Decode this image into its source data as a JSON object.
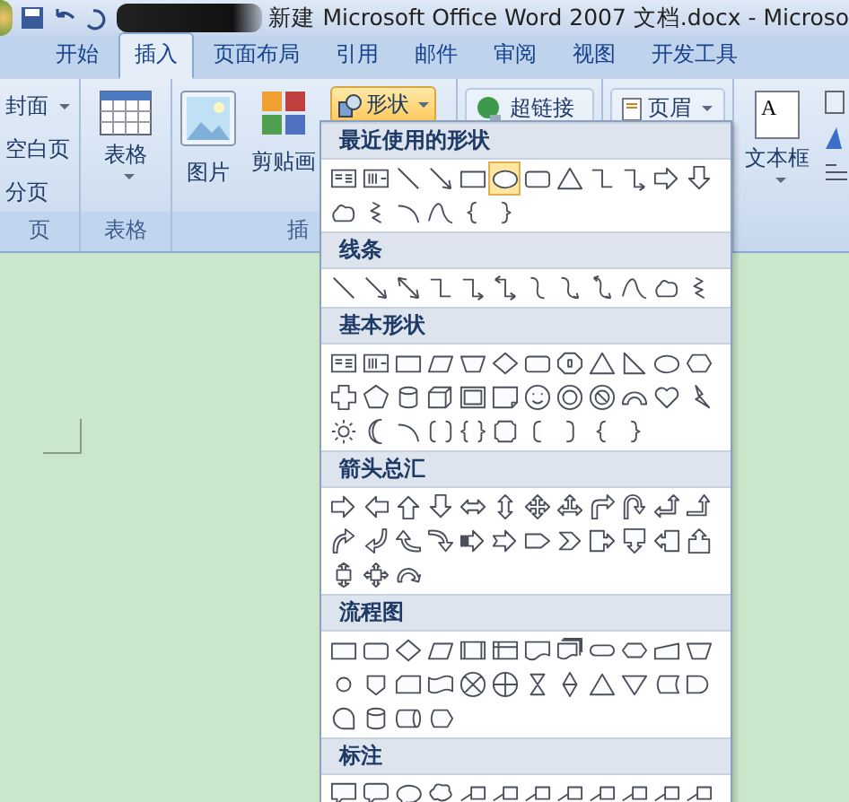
{
  "title_bar": {
    "title": "新建 Microsoft Office Word 2007 文档.docx - Microso"
  },
  "tabs": [
    {
      "label": "开始",
      "selected": false
    },
    {
      "label": "插入",
      "selected": true
    },
    {
      "label": "页面布局",
      "selected": false
    },
    {
      "label": "引用",
      "selected": false
    },
    {
      "label": "邮件",
      "selected": false
    },
    {
      "label": "审阅",
      "selected": false
    },
    {
      "label": "视图",
      "selected": false
    },
    {
      "label": "开发工具",
      "selected": false
    }
  ],
  "ribbon": {
    "pages_group": {
      "label": "页",
      "buttons": [
        {
          "label": "封面",
          "dropdown": true
        },
        {
          "label": "空白页",
          "dropdown": false
        },
        {
          "label": "分页",
          "dropdown": false
        }
      ]
    },
    "table_group": {
      "label": "表格",
      "button": "表格"
    },
    "illustrations_group": {
      "label": "插",
      "buttons": [
        {
          "label": "图片"
        },
        {
          "label": "剪贴画"
        }
      ],
      "shapes_button": {
        "label": "形状",
        "open": true
      }
    },
    "links_group": {
      "button": "超链接"
    },
    "header_group": {
      "button": "页眉"
    },
    "text_group": {
      "button": "文本框",
      "icon_letter": "A"
    }
  },
  "shapes_menu": {
    "sections": [
      {
        "title": "最近使用的形状",
        "shapes": [
          {
            "kind": "textbox",
            "selected": false
          },
          {
            "kind": "vtextbox",
            "selected": false
          },
          {
            "kind": "line",
            "selected": false
          },
          {
            "kind": "arrow-line",
            "selected": false
          },
          {
            "kind": "rect",
            "selected": false
          },
          {
            "kind": "oval",
            "selected": true
          },
          {
            "kind": "rounded-rect",
            "selected": false
          },
          {
            "kind": "triangle",
            "selected": false
          },
          {
            "kind": "elbow",
            "selected": false
          },
          {
            "kind": "elbow-arrow",
            "selected": false
          },
          {
            "kind": "arrow-right",
            "selected": false
          },
          {
            "kind": "arrow-down",
            "selected": false
          },
          {
            "kind": "freeform",
            "selected": false
          },
          {
            "kind": "scribble",
            "selected": false
          },
          {
            "kind": "arc",
            "selected": false
          },
          {
            "kind": "curve",
            "selected": false
          },
          {
            "kind": "brace-left",
            "selected": false
          },
          {
            "kind": "brace-right",
            "selected": false
          }
        ]
      },
      {
        "title": "线条",
        "shapes": [
          {
            "kind": "line",
            "selected": false
          },
          {
            "kind": "arrow-line",
            "selected": false
          },
          {
            "kind": "double-arrow-line",
            "selected": false
          },
          {
            "kind": "elbow",
            "selected": false
          },
          {
            "kind": "elbow-arrow",
            "selected": false
          },
          {
            "kind": "elbow-double-arrow",
            "selected": false
          },
          {
            "kind": "curve-connector",
            "selected": false
          },
          {
            "kind": "curve-arrow",
            "selected": false
          },
          {
            "kind": "curve-double-arrow",
            "selected": false
          },
          {
            "kind": "curve",
            "selected": false
          },
          {
            "kind": "freeform",
            "selected": false
          },
          {
            "kind": "scribble",
            "selected": false
          }
        ]
      },
      {
        "title": "基本形状",
        "shapes": [
          {
            "kind": "textbox",
            "selected": false
          },
          {
            "kind": "vtextbox",
            "selected": false
          },
          {
            "kind": "rect",
            "selected": false
          },
          {
            "kind": "parallelogram",
            "selected": false
          },
          {
            "kind": "trapezoid",
            "selected": false
          },
          {
            "kind": "diamond",
            "selected": false
          },
          {
            "kind": "rounded-rect",
            "selected": false
          },
          {
            "kind": "octagon",
            "selected": false
          },
          {
            "kind": "triangle",
            "selected": false
          },
          {
            "kind": "right-triangle",
            "selected": false
          },
          {
            "kind": "oval",
            "selected": false
          },
          {
            "kind": "hexagon",
            "selected": false
          },
          {
            "kind": "cross",
            "selected": false
          },
          {
            "kind": "pentagon",
            "selected": false
          },
          {
            "kind": "can",
            "selected": false
          },
          {
            "kind": "cube",
            "selected": false
          },
          {
            "kind": "bevel",
            "selected": false
          },
          {
            "kind": "folded-corner",
            "selected": false
          },
          {
            "kind": "smiley",
            "selected": false
          },
          {
            "kind": "donut",
            "selected": false
          },
          {
            "kind": "no-symbol",
            "selected": false
          },
          {
            "kind": "block-arc",
            "selected": false
          },
          {
            "kind": "heart",
            "selected": false
          },
          {
            "kind": "lightning",
            "selected": false
          },
          {
            "kind": "sun",
            "selected": false
          },
          {
            "kind": "moon",
            "selected": false
          },
          {
            "kind": "arc",
            "selected": false
          },
          {
            "kind": "bracket-pair",
            "selected": false
          },
          {
            "kind": "brace-pair",
            "selected": false
          },
          {
            "kind": "plaque",
            "selected": false
          },
          {
            "kind": "bracket-left",
            "selected": false
          },
          {
            "kind": "bracket-right",
            "selected": false
          },
          {
            "kind": "brace-left",
            "selected": false
          },
          {
            "kind": "brace-right",
            "selected": false
          }
        ]
      },
      {
        "title": "箭头总汇",
        "shapes": [
          {
            "kind": "arrow-right",
            "selected": false
          },
          {
            "kind": "arrow-left",
            "selected": false
          },
          {
            "kind": "arrow-up",
            "selected": false
          },
          {
            "kind": "arrow-down",
            "selected": false
          },
          {
            "kind": "arrow-left-right",
            "selected": false
          },
          {
            "kind": "arrow-up-down",
            "selected": false
          },
          {
            "kind": "quad-arrow",
            "selected": false
          },
          {
            "kind": "left-right-up-arrow",
            "selected": false
          },
          {
            "kind": "bent-arrow",
            "selected": false
          },
          {
            "kind": "u-turn-arrow",
            "selected": false
          },
          {
            "kind": "left-up-arrow",
            "selected": false
          },
          {
            "kind": "bent-up-arrow",
            "selected": false
          },
          {
            "kind": "curved-right-arrow",
            "selected": false
          },
          {
            "kind": "curved-left-arrow",
            "selected": false
          },
          {
            "kind": "curved-up-arrow",
            "selected": false
          },
          {
            "kind": "curved-down-arrow",
            "selected": false
          },
          {
            "kind": "striped-arrow",
            "selected": false
          },
          {
            "kind": "notched-arrow",
            "selected": false
          },
          {
            "kind": "pentagon-arrow",
            "selected": false
          },
          {
            "kind": "chevron",
            "selected": false
          },
          {
            "kind": "right-callout-arrow",
            "selected": false
          },
          {
            "kind": "down-callout-arrow",
            "selected": false
          },
          {
            "kind": "left-callout-arrow",
            "selected": false
          },
          {
            "kind": "up-callout-arrow",
            "selected": false
          },
          {
            "kind": "up-down-callout-arrow",
            "selected": false
          },
          {
            "kind": "quad-callout-arrow",
            "selected": false
          },
          {
            "kind": "circular-arrow",
            "selected": false
          }
        ]
      },
      {
        "title": "流程图",
        "shapes": [
          {
            "kind": "rect",
            "selected": false
          },
          {
            "kind": "rounded-rect",
            "selected": false
          },
          {
            "kind": "diamond",
            "selected": false
          },
          {
            "kind": "parallelogram",
            "selected": false
          },
          {
            "kind": "predefined-process",
            "selected": false
          },
          {
            "kind": "internal-storage",
            "selected": false
          },
          {
            "kind": "document",
            "selected": false
          },
          {
            "kind": "multidocument",
            "selected": false
          },
          {
            "kind": "terminator",
            "selected": false
          },
          {
            "kind": "preparation",
            "selected": false
          },
          {
            "kind": "manual-input",
            "selected": false
          },
          {
            "kind": "trapezoid",
            "selected": false
          },
          {
            "kind": "connector",
            "selected": false
          },
          {
            "kind": "offpage-connector",
            "selected": false
          },
          {
            "kind": "card",
            "selected": false
          },
          {
            "kind": "punched-tape",
            "selected": false
          },
          {
            "kind": "summing-junction",
            "selected": false
          },
          {
            "kind": "or",
            "selected": false
          },
          {
            "kind": "collate",
            "selected": false
          },
          {
            "kind": "sort",
            "selected": false
          },
          {
            "kind": "triangle",
            "selected": false
          },
          {
            "kind": "merge",
            "selected": false
          },
          {
            "kind": "stored-data",
            "selected": false
          },
          {
            "kind": "delay",
            "selected": false
          },
          {
            "kind": "sequential-access",
            "selected": false
          },
          {
            "kind": "can",
            "selected": false
          },
          {
            "kind": "direct-access",
            "selected": false
          },
          {
            "kind": "display",
            "selected": false
          }
        ]
      },
      {
        "title": "标注",
        "shapes": [
          {
            "kind": "rect-callout",
            "selected": false
          },
          {
            "kind": "rounded-callout",
            "selected": false
          },
          {
            "kind": "oval-callout",
            "selected": false
          },
          {
            "kind": "cloud-callout",
            "selected": false
          },
          {
            "kind": "line-callout",
            "selected": false
          },
          {
            "kind": "line-callout",
            "selected": false
          },
          {
            "kind": "line-callout",
            "selected": false
          },
          {
            "kind": "line-callout",
            "selected": false
          },
          {
            "kind": "line-callout",
            "selected": false
          },
          {
            "kind": "line-callout",
            "selected": false
          },
          {
            "kind": "line-callout",
            "selected": false
          },
          {
            "kind": "line-callout",
            "selected": false
          }
        ]
      }
    ]
  }
}
